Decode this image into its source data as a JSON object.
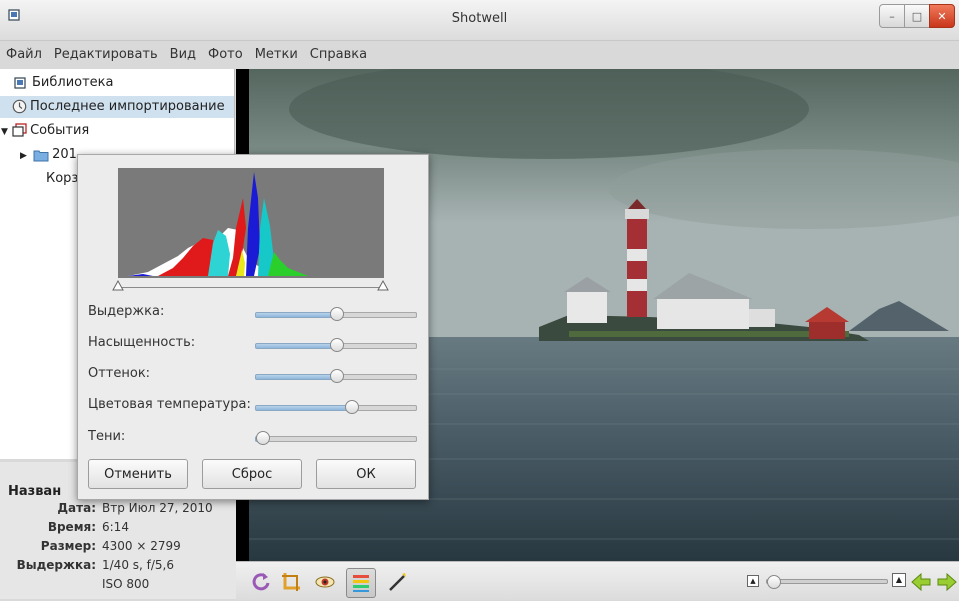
{
  "window": {
    "title": "Shotwell"
  },
  "menu": [
    "Файл",
    "Редактировать",
    "Вид",
    "Фото",
    "Метки",
    "Справка"
  ],
  "sidebar": {
    "items": [
      {
        "label": "Библиотека",
        "icon": "library-icon",
        "selected": false
      },
      {
        "label": "Последнее импортирование",
        "icon": "clock-icon",
        "selected": true
      },
      {
        "label": "События",
        "icon": "events-icon",
        "expanded": true
      },
      {
        "label": "201",
        "icon": "folder-icon",
        "expanded": false
      },
      {
        "label": "Корз",
        "icon": "trash-icon"
      }
    ]
  },
  "info": {
    "name_key": "Назван",
    "rows": [
      {
        "key": "Дата:",
        "value": "Втр Июл 27, 2010"
      },
      {
        "key": "Время:",
        "value": "6:14"
      },
      {
        "key": "Размер:",
        "value": "4300 × 2799"
      },
      {
        "key": "Выдержка:",
        "value": "1/40 s, f/5,6"
      },
      {
        "key": "",
        "value": "ISO 800"
      }
    ]
  },
  "adjust_dialog": {
    "sliders": [
      {
        "label": "Выдержка:",
        "value": 0.5
      },
      {
        "label": "Насыщенность:",
        "value": 0.5
      },
      {
        "label": "Оттенок:",
        "value": 0.5
      },
      {
        "label": "Цветовая температура:",
        "value": 0.6
      },
      {
        "label": "Тени:",
        "value": 0.0
      }
    ],
    "buttons": {
      "cancel": "Отменить",
      "reset": "Сброс",
      "ok": "ОК"
    }
  },
  "toolbar": {
    "tools": [
      "rotate-icon",
      "crop-icon",
      "red-eye-icon",
      "adjust-icon",
      "straighten-icon"
    ],
    "zoom_level": 0.0,
    "nav": [
      "previous-icon",
      "next-icon"
    ]
  },
  "colors": {
    "selection": "#cfe0ef",
    "accent": "#8fb6dc",
    "close_button": "#d8462a"
  }
}
